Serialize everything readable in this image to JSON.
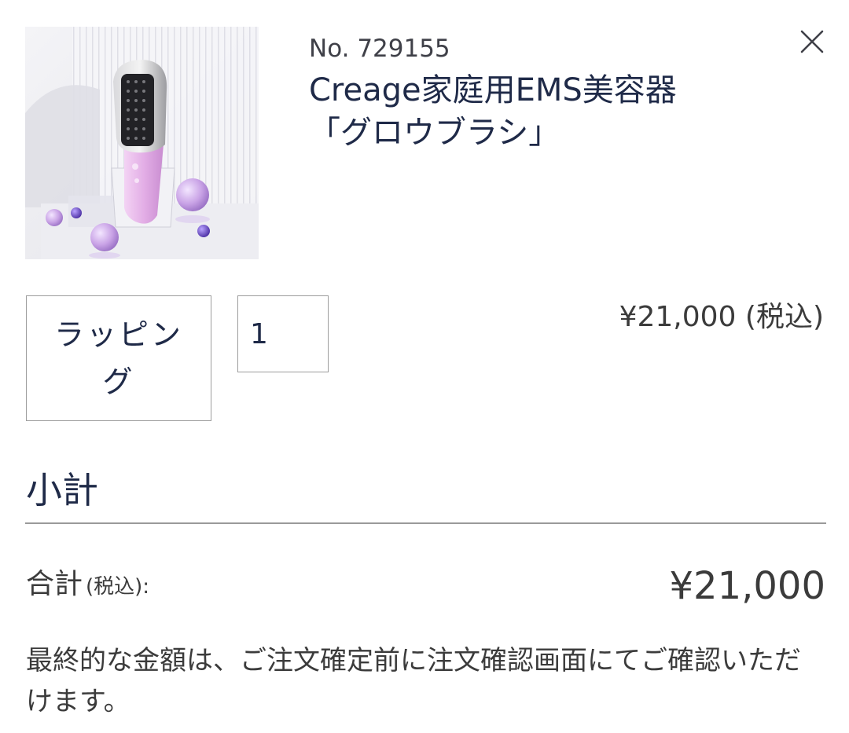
{
  "product": {
    "number": "No. 729155",
    "name_line1": "Creage家庭用EMS美容器",
    "name_line2": "「グロウブラシ」",
    "image_alt": "Creage家庭用EMS美容器「グロウブラシ」"
  },
  "header": {
    "close_icon": "close-icon"
  },
  "options": {
    "wrapping_label": "ラッピング",
    "quantity_value": "1",
    "unit_price": "¥21,000 (税込)"
  },
  "subtotal": {
    "heading": "小計",
    "total_label": "合計",
    "total_label_small": "(税込):",
    "total_value": "¥21,000",
    "note": "最終的な金額は、ご注文確定前に注文確認画面にてご確認いただけます。"
  },
  "colors": {
    "navy_text": "#1f2a48",
    "body_text": "#3b3b3b",
    "border": "#9c9c9c",
    "divider": "#9a9a9a",
    "product_pink": "#e7b8ea",
    "sphere_lavender": "#c9a3e6",
    "sphere_violet": "#7a55c4"
  }
}
